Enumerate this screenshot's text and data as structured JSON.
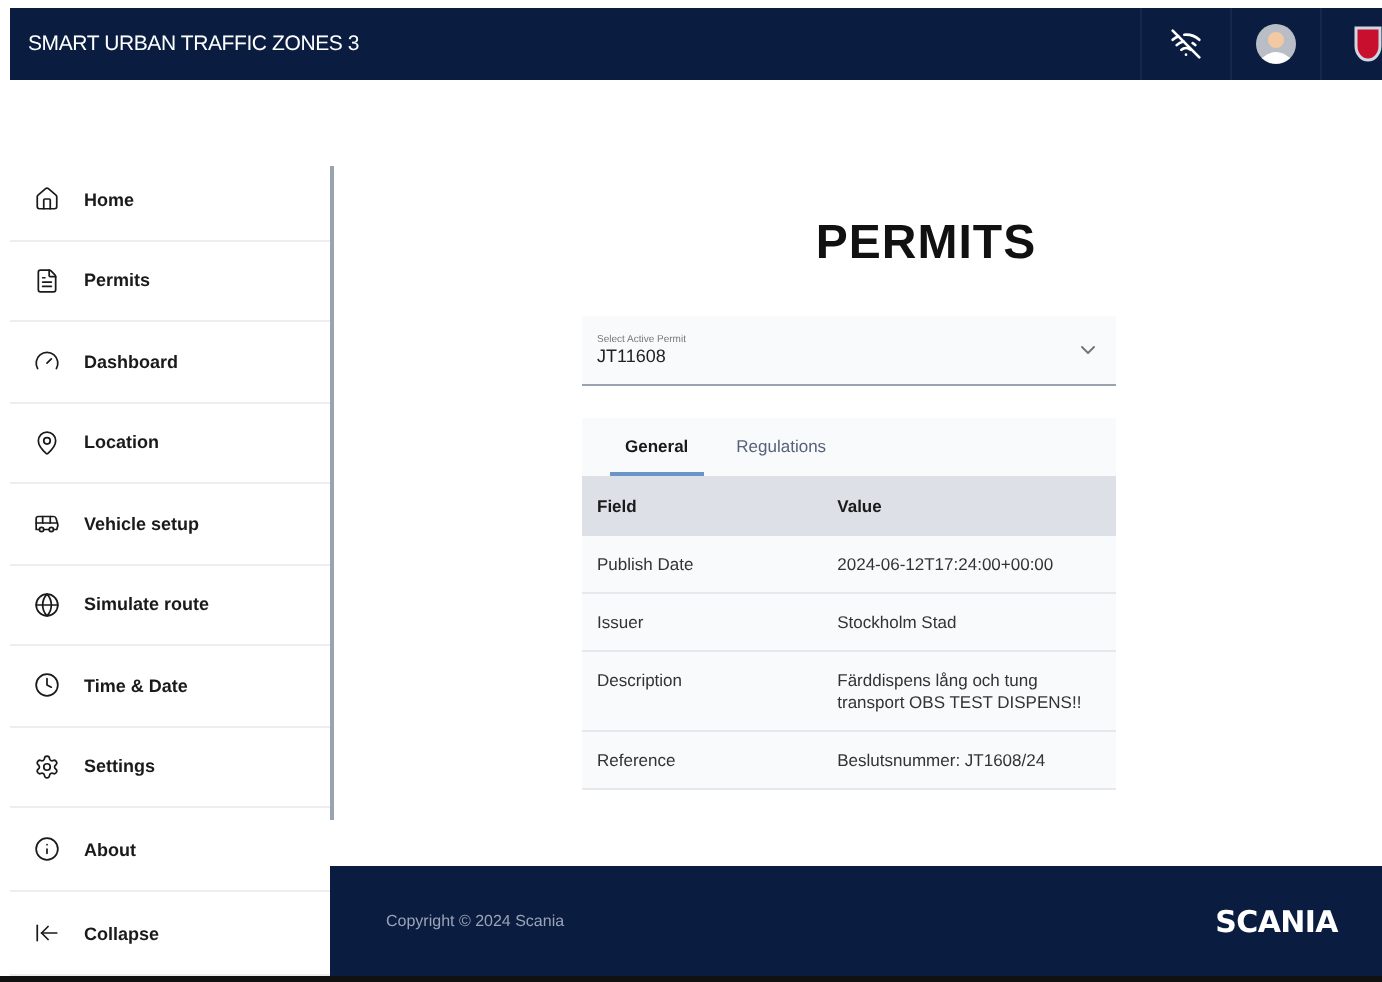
{
  "header": {
    "title": "SMART URBAN TRAFFIC ZONES 3"
  },
  "sidebar": {
    "items": [
      {
        "label": "Home"
      },
      {
        "label": "Permits"
      },
      {
        "label": "Dashboard"
      },
      {
        "label": "Location"
      },
      {
        "label": "Vehicle setup"
      },
      {
        "label": "Simulate route"
      },
      {
        "label": "Time & Date"
      },
      {
        "label": "Settings"
      }
    ],
    "bottom_items": [
      {
        "label": "About"
      },
      {
        "label": "Collapse"
      }
    ]
  },
  "page_title": "PERMITS",
  "permit_select": {
    "label": "Select Active Permit",
    "value": "JT11608"
  },
  "tabs": [
    {
      "label": "General",
      "selected": true
    },
    {
      "label": "Regulations",
      "selected": false
    }
  ],
  "table": {
    "columns": [
      "Field",
      "Value"
    ],
    "rows": [
      [
        "Publish Date",
        "2024-06-12T17:24:00+00:00"
      ],
      [
        "Issuer",
        "Stockholm Stad"
      ],
      [
        "Description",
        "Färddispens lång och tung transport OBS TEST DISPENS!!"
      ],
      [
        "Reference",
        "Beslutsnummer: JT1608/24"
      ]
    ]
  },
  "footer": {
    "copyright": "Copyright © 2024 Scania",
    "logo": "SCANIA"
  }
}
